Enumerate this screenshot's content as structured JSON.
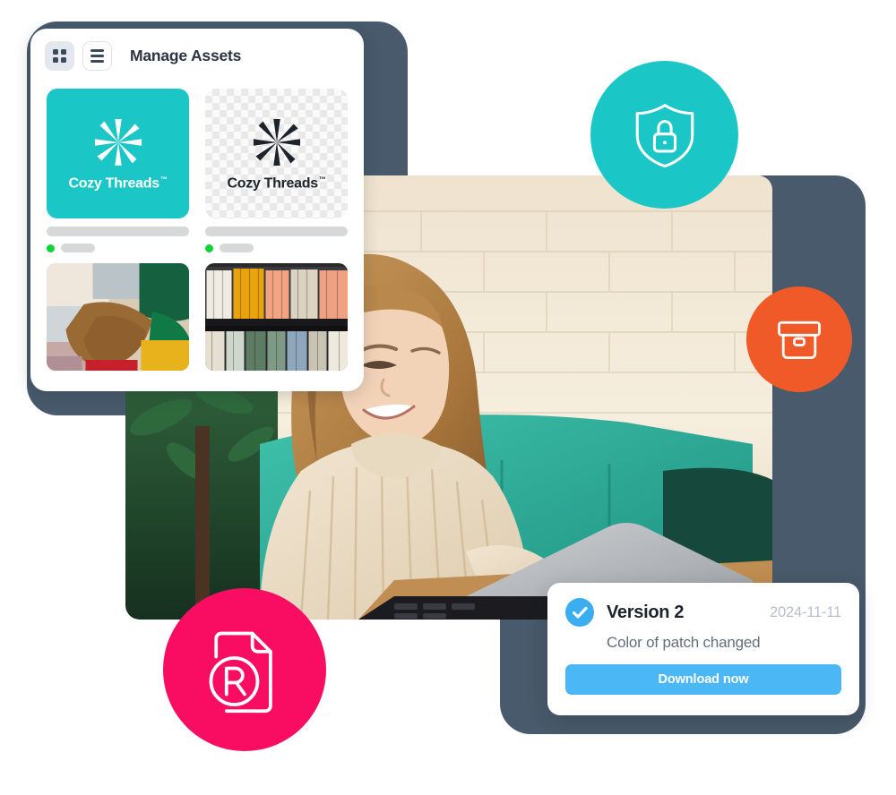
{
  "window": {
    "title": "Manage Assets",
    "toolbar": {
      "grid_view_label": "Grid view",
      "list_view_label": "List view",
      "grid_icon": "grid-icon",
      "list_icon": "list-icon"
    },
    "assets": [
      {
        "name": "Cozy Threads",
        "trademark": "™",
        "background": "solid-teal",
        "background_color": "#1ac6c6",
        "logo_color": "#ffffff",
        "status": "active",
        "status_color": "#10d338",
        "logo_icon": "starburst-logo-icon"
      },
      {
        "name": "Cozy Threads",
        "trademark": "™",
        "background": "transparent-checkerboard",
        "background_color": "#fafafa",
        "logo_color": "#1d232b",
        "status": "active",
        "status_color": "#10d338",
        "logo_icon": "starburst-logo-icon"
      }
    ],
    "thumbnails": [
      {
        "alt": "Folded knit garments on wooden surface"
      },
      {
        "alt": "Clothing rack with folded shirts"
      }
    ]
  },
  "hero": {
    "alt": "Woman in cream knit sweater smiling while using a laptop on a teal sofa"
  },
  "badges": [
    {
      "icon": "shield-lock-icon",
      "label": "Secure",
      "color": "#1ac6c6"
    },
    {
      "icon": "archive-box-icon",
      "label": "Archive",
      "color": "#f05a28"
    },
    {
      "icon": "registered-trademark-document-icon",
      "label": "Trademark document",
      "color": "#f90d63",
      "glyph": "R"
    }
  ],
  "version_card": {
    "status_icon": "check-circle-icon",
    "status_color": "#3aaef0",
    "title": "Version 2",
    "date": "2024-11-11",
    "description": "Color of patch changed",
    "button_label": "Download now",
    "button_color": "#4bb8f5"
  },
  "theme": {
    "panel_color": "#485a6b",
    "teal": "#1ac6c6",
    "orange": "#f05a28",
    "pink": "#f90d63",
    "blue": "#4bb8f5",
    "green": "#10d338"
  }
}
